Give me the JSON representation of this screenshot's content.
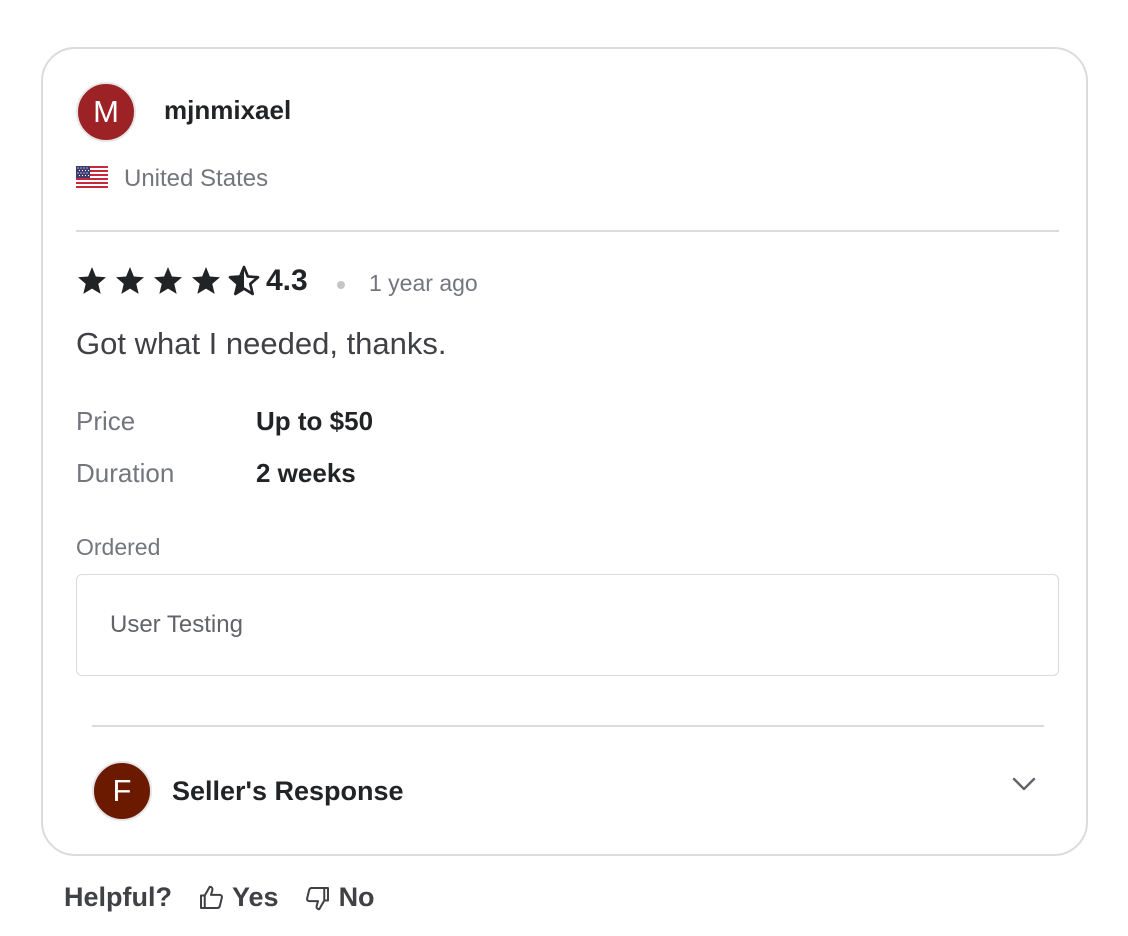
{
  "review": {
    "reviewer": {
      "avatar_letter": "M",
      "avatar_color": "#9c2226",
      "username": "mjnmixael",
      "country": "United States",
      "flag_icon": "us-flag-icon"
    },
    "rating": {
      "value": 4.3,
      "display": "4.3",
      "max": 5,
      "star_icons": [
        "star-icon",
        "star-icon",
        "star-icon",
        "star-icon",
        "half-star-icon"
      ]
    },
    "time_ago": "1 year ago",
    "comment": "Got what I needed, thanks.",
    "details": {
      "price_label": "Price",
      "price_value": "Up to $50",
      "duration_label": "Duration",
      "duration_value": "2 weeks"
    },
    "ordered": {
      "label": "Ordered",
      "item": "User Testing"
    },
    "seller_response": {
      "avatar_letter": "F",
      "avatar_color": "#6b1a00",
      "label": "Seller's Response",
      "toggle_icon": "chevron-down-icon"
    }
  },
  "helpful": {
    "label": "Helpful?",
    "yes_label": "Yes",
    "yes_icon": "thumbs-up-icon",
    "no_label": "No",
    "no_icon": "thumbs-down-icon"
  }
}
